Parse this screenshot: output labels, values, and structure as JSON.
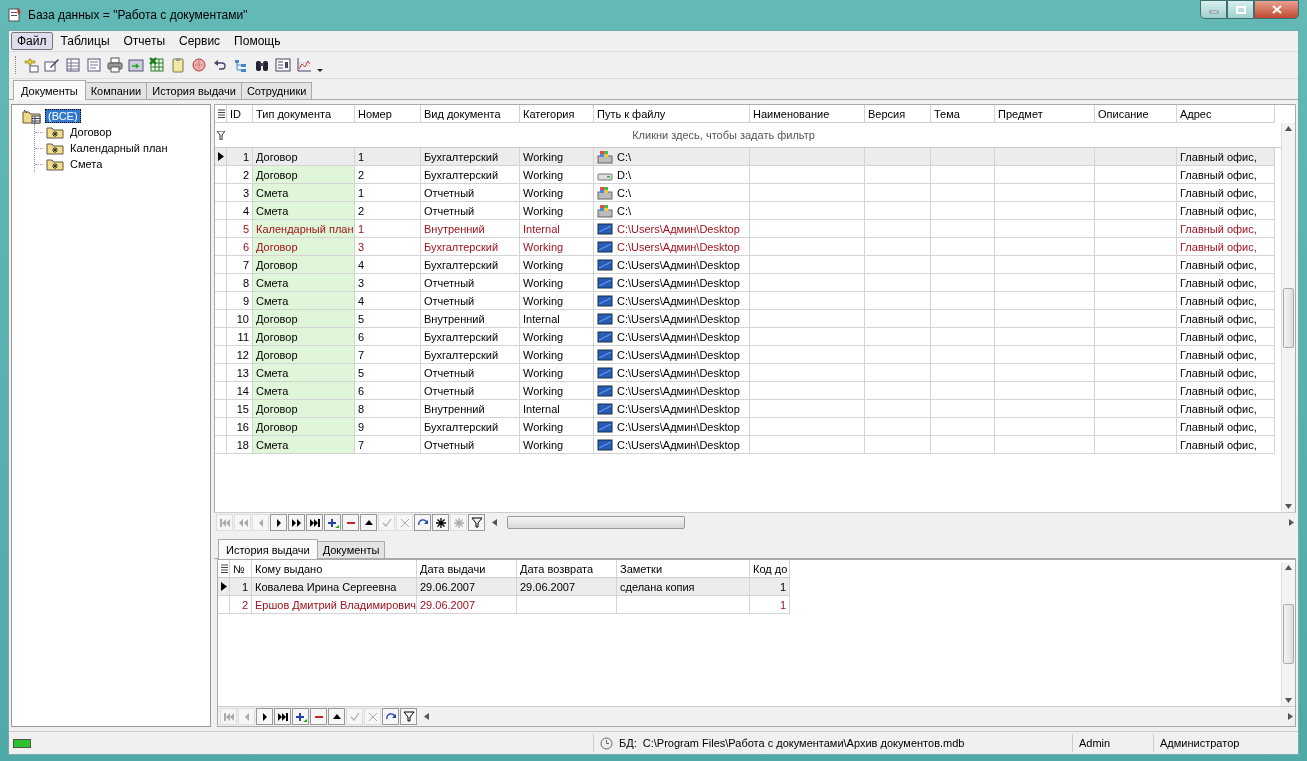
{
  "window": {
    "title": "База данных = \"Работа с документами\""
  },
  "menu": [
    {
      "label": "Файл",
      "selected": true
    },
    {
      "label": "Таблицы",
      "selected": false
    },
    {
      "label": "Отчеты",
      "selected": false
    },
    {
      "label": "Сервис",
      "selected": false
    },
    {
      "label": "Помощь",
      "selected": false
    }
  ],
  "tabs": [
    {
      "label": "Документы",
      "selected": true
    },
    {
      "label": "Компании",
      "selected": false
    },
    {
      "label": "История выдачи",
      "selected": false
    },
    {
      "label": "Сотрудники",
      "selected": false
    }
  ],
  "tree": [
    {
      "label": "(ВСЕ)",
      "selected": true,
      "children": [
        {
          "label": "Договор",
          "selected": false
        },
        {
          "label": "Календарный план",
          "selected": false
        },
        {
          "label": "Смета",
          "selected": false
        }
      ]
    }
  ],
  "documents_grid": {
    "columns": [
      "ID",
      "Тип документа",
      "Номер",
      "Вид документа",
      "Категория",
      "Путь к файлу",
      "Наименование",
      "Версия",
      "Тема",
      "Предмет",
      "Описание",
      "Адрес"
    ],
    "filter_hint": "Кликни здесь, чтобы задать фильтр",
    "rows": [
      {
        "selected": true,
        "highlighted": false,
        "kind": "system",
        "id": "1",
        "type": "Договор",
        "number": "1",
        "view": "Бухгалтерский",
        "category": "Working",
        "path": "C:\\",
        "address": "Главный офис,"
      },
      {
        "selected": false,
        "highlighted": false,
        "kind": "disk",
        "id": "2",
        "type": "Договор",
        "number": "2",
        "view": "Бухгалтерский",
        "category": "Working",
        "path": "D:\\",
        "address": "Главный офис,"
      },
      {
        "selected": false,
        "highlighted": false,
        "kind": "system",
        "id": "3",
        "type": "Смета",
        "number": "1",
        "view": "Отчетный",
        "category": "Working",
        "path": "C:\\",
        "address": "Главный офис,"
      },
      {
        "selected": false,
        "highlighted": false,
        "kind": "system",
        "id": "4",
        "type": "Смета",
        "number": "2",
        "view": "Отчетный",
        "category": "Working",
        "path": "C:\\",
        "address": "Главный офис,"
      },
      {
        "selected": false,
        "highlighted": true,
        "kind": "desktop",
        "id": "5",
        "type": "Календарный план",
        "number": "1",
        "view": "Внутренний",
        "category": "Internal",
        "path": "C:\\Users\\Админ\\Desktop",
        "address": "Главный офис,"
      },
      {
        "selected": false,
        "highlighted": true,
        "kind": "desktop",
        "id": "6",
        "type": "Договор",
        "number": "3",
        "view": "Бухгалтерский",
        "category": "Working",
        "path": "C:\\Users\\Админ\\Desktop",
        "address": "Главный офис,"
      },
      {
        "selected": false,
        "highlighted": false,
        "kind": "desktop",
        "id": "7",
        "type": "Договор",
        "number": "4",
        "view": "Бухгалтерский",
        "category": "Working",
        "path": "C:\\Users\\Админ\\Desktop",
        "address": "Главный офис,"
      },
      {
        "selected": false,
        "highlighted": false,
        "kind": "desktop",
        "id": "8",
        "type": "Смета",
        "number": "3",
        "view": "Отчетный",
        "category": "Working",
        "path": "C:\\Users\\Админ\\Desktop",
        "address": "Главный офис,"
      },
      {
        "selected": false,
        "highlighted": false,
        "kind": "desktop",
        "id": "9",
        "type": "Смета",
        "number": "4",
        "view": "Отчетный",
        "category": "Working",
        "path": "C:\\Users\\Админ\\Desktop",
        "address": "Главный офис,"
      },
      {
        "selected": false,
        "highlighted": false,
        "kind": "desktop",
        "id": "10",
        "type": "Договор",
        "number": "5",
        "view": "Внутренний",
        "category": "Internal",
        "path": "C:\\Users\\Админ\\Desktop",
        "address": "Главный офис,"
      },
      {
        "selected": false,
        "highlighted": false,
        "kind": "desktop",
        "id": "11",
        "type": "Договор",
        "number": "6",
        "view": "Бухгалтерский",
        "category": "Working",
        "path": "C:\\Users\\Админ\\Desktop",
        "address": "Главный офис,"
      },
      {
        "selected": false,
        "highlighted": false,
        "kind": "desktop",
        "id": "12",
        "type": "Договор",
        "number": "7",
        "view": "Бухгалтерский",
        "category": "Working",
        "path": "C:\\Users\\Админ\\Desktop",
        "address": "Главный офис,"
      },
      {
        "selected": false,
        "highlighted": false,
        "kind": "desktop",
        "id": "13",
        "type": "Смета",
        "number": "5",
        "view": "Отчетный",
        "category": "Working",
        "path": "C:\\Users\\Админ\\Desktop",
        "address": "Главный офис,"
      },
      {
        "selected": false,
        "highlighted": false,
        "kind": "desktop",
        "id": "14",
        "type": "Смета",
        "number": "6",
        "view": "Отчетный",
        "category": "Working",
        "path": "C:\\Users\\Админ\\Desktop",
        "address": "Главный офис,"
      },
      {
        "selected": false,
        "highlighted": false,
        "kind": "desktop",
        "id": "15",
        "type": "Договор",
        "number": "8",
        "view": "Внутренний",
        "category": "Internal",
        "path": "C:\\Users\\Админ\\Desktop",
        "address": "Главный офис,"
      },
      {
        "selected": false,
        "highlighted": false,
        "kind": "desktop",
        "id": "16",
        "type": "Договор",
        "number": "9",
        "view": "Бухгалтерский",
        "category": "Working",
        "path": "C:\\Users\\Админ\\Desktop",
        "address": "Главный офис,"
      },
      {
        "selected": false,
        "highlighted": false,
        "kind": "desktop",
        "id": "18",
        "type": "Смета",
        "number": "7",
        "view": "Отчетный",
        "category": "Working",
        "path": "C:\\Users\\Админ\\Desktop",
        "address": "Главный офис,"
      }
    ]
  },
  "documents_navigator": [
    {
      "kind": "first",
      "disabled": true
    },
    {
      "kind": "prior-page",
      "disabled": true
    },
    {
      "kind": "prior",
      "disabled": true
    },
    {
      "kind": "next",
      "disabled": false
    },
    {
      "kind": "next-page",
      "disabled": false
    },
    {
      "kind": "last",
      "disabled": false
    },
    {
      "kind": "insert",
      "disabled": false
    },
    {
      "kind": "delete",
      "disabled": false
    },
    {
      "kind": "edit",
      "disabled": false
    },
    {
      "kind": "post",
      "disabled": true
    },
    {
      "kind": "cancel",
      "disabled": true
    },
    {
      "kind": "refresh",
      "disabled": false
    },
    {
      "kind": "bookmark",
      "disabled": false
    },
    {
      "kind": "clear-bookmark",
      "disabled": true
    },
    {
      "kind": "filter",
      "disabled": false
    }
  ],
  "detail_tabs": [
    {
      "label": "История выдачи",
      "selected": true
    },
    {
      "label": "Документы",
      "selected": false
    }
  ],
  "history_grid": {
    "columns": [
      "№",
      "Кому выдано",
      "Дата выдачи",
      "Дата возврата",
      "Заметки",
      "Код до"
    ],
    "rows": [
      {
        "selected": true,
        "highlighted": false,
        "number": "1",
        "recipient": "Ковалева Ирина Сергеевна",
        "issued": "29.06.2007",
        "returned": "29.06.2007",
        "notes": "сделана копия",
        "doc_code": "1"
      },
      {
        "selected": false,
        "highlighted": true,
        "number": "2",
        "recipient": "Ершов Дмитрий Владимирович",
        "issued": "29.06.2007",
        "doc_code": "1"
      }
    ]
  },
  "history_navigator": [
    {
      "kind": "first",
      "disabled": true
    },
    {
      "kind": "prior",
      "disabled": true
    },
    {
      "kind": "next",
      "disabled": false
    },
    {
      "kind": "last",
      "disabled": false
    },
    {
      "kind": "insert",
      "disabled": false
    },
    {
      "kind": "delete",
      "disabled": false
    },
    {
      "kind": "edit",
      "disabled": false
    },
    {
      "kind": "post",
      "disabled": true
    },
    {
      "kind": "cancel",
      "disabled": true
    },
    {
      "kind": "refresh",
      "disabled": false
    },
    {
      "kind": "filter",
      "disabled": false
    }
  ],
  "status_bar": {
    "db_label": "БД:",
    "db_path": "C:\\Program Files\\Работа с документами\\Архив документов.mdb",
    "user": "Admin",
    "role": "Администратор"
  }
}
